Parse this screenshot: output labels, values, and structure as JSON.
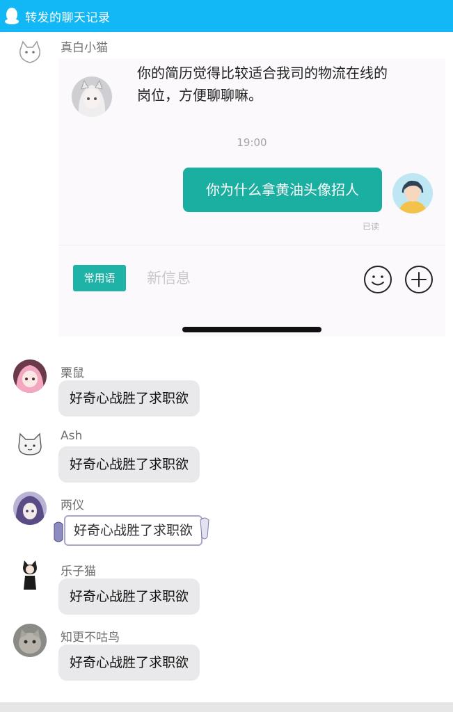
{
  "window": {
    "title": "转发的聊天记录"
  },
  "forwarded": {
    "sender": "真白小猫",
    "incoming_message": "你的简历觉得比较适合我司的物流在线的岗位，方便聊聊嘛。",
    "time": "19:00",
    "outgoing_message": "你为什么拿黄油头像招人",
    "read_status": "已读",
    "common_phrases_label": "常用语",
    "input_placeholder": "新信息"
  },
  "messages": [
    {
      "sender": "栗鼠",
      "text": "好奇心战胜了求职欲"
    },
    {
      "sender": "Ash",
      "text": "好奇心战胜了求职欲"
    },
    {
      "sender": "两仪",
      "text": "好奇心战胜了求职欲"
    },
    {
      "sender": "乐子猫",
      "text": "好奇心战胜了求职欲"
    },
    {
      "sender": "知更不咕鸟",
      "text": "好奇心战胜了求职欲"
    }
  ],
  "colors": {
    "titlebar": "#12b7f5",
    "outgoing_bubble": "#1bafa2",
    "phrase_button": "#1eb3a6",
    "incoming_bubble": "#e9e9eb"
  },
  "icons": [
    "qq-penguin-icon",
    "smiley-icon",
    "plus-icon"
  ]
}
